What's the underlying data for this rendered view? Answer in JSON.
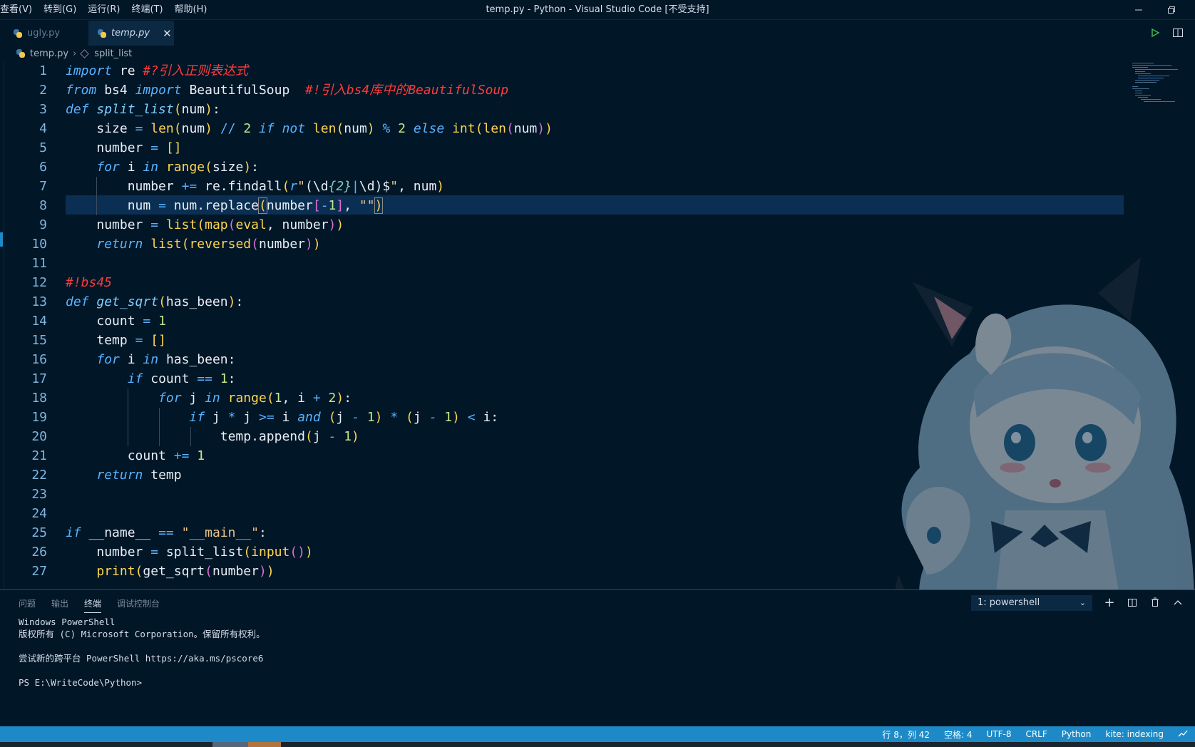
{
  "menu": [
    "查看(V)",
    "转到(G)",
    "运行(R)",
    "终端(T)",
    "帮助(H)"
  ],
  "window_title": "temp.py - Python - Visual Studio Code [不受支持]",
  "tabs": [
    {
      "label": "ugly.py",
      "active": false
    },
    {
      "label": "temp.py",
      "active": true
    }
  ],
  "breadcrumb": {
    "file": "temp.py",
    "symbol": "split_list"
  },
  "editor": {
    "current_line": 8,
    "lines": [
      "import re #?引入正则表达式",
      "from bs4 import BeautifulSoup  #!引入bs4库中的BeautifulSoup",
      "def split_list(num):",
      "    size = len(num) // 2 if not len(num) % 2 else int(len(num))",
      "    number = []",
      "    for i in range(size):",
      "        number += re.findall(r\"(\\d{2}|\\d)$\", num)",
      "        num = num.replace(number[-1], \"\")",
      "    number = list(map(eval, number))",
      "    return list(reversed(number))",
      "",
      "#!bs45",
      "def get_sqrt(has_been):",
      "    count = 1",
      "    temp = []",
      "    for i in has_been:",
      "        if count == 1:",
      "            for j in range(1, i + 2):",
      "                if j * j >= i and (j - 1) * (j - 1) < i:",
      "                    temp.append(j - 1)",
      "        count += 1",
      "    return temp",
      "",
      "",
      "if __name__ == \"__main__\":",
      "    number = split_list(input())",
      "    print(get_sqrt(number))"
    ]
  },
  "panel": {
    "tabs": [
      "问题",
      "输出",
      "终端",
      "调试控制台"
    ],
    "active_tab": "终端",
    "terminal_select": "1: powershell",
    "terminal_lines": [
      "Windows PowerShell",
      "版权所有 (C) Microsoft Corporation。保留所有权利。",
      "",
      "尝试新的跨平台 PowerShell https://aka.ms/pscore6",
      "",
      "PS E:\\WriteCode\\Python>"
    ]
  },
  "status": {
    "position": "行 8，列 42",
    "spaces": "空格: 4",
    "encoding": "UTF-8",
    "eol": "CRLF",
    "language": "Python",
    "kite": "kite: indexing"
  },
  "colors": {
    "background": "#011627",
    "accent": "#1d8ac7",
    "keyword": "#57b3ff",
    "function": "#ffd54f",
    "comment": "#ff3b3b"
  }
}
